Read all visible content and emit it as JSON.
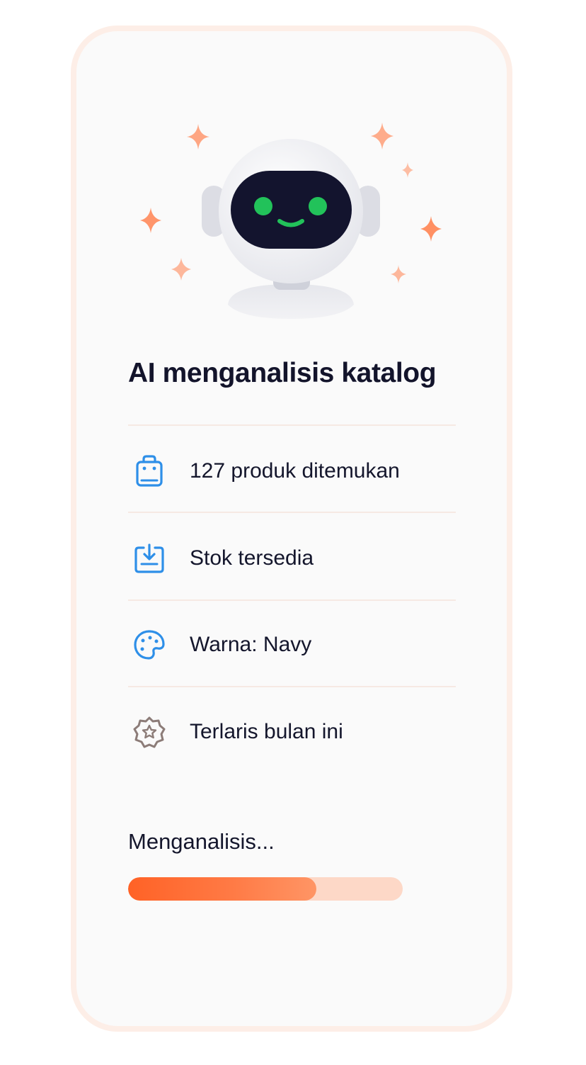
{
  "analysis": {
    "title": "AI menganalisis katalog",
    "items": [
      {
        "icon": "shopping-bag-icon",
        "label": "127 produk ditemukan"
      },
      {
        "icon": "box-download-icon",
        "label": "Stok tersedia"
      },
      {
        "icon": "color-palette-icon",
        "label": "Warna: Navy"
      },
      {
        "icon": "star-badge-icon",
        "label": "Terlaris bulan ini"
      }
    ],
    "status_text": "Menganalisis...",
    "progress_fraction": 0.685
  },
  "colors": {
    "accent": "#FF6A2B",
    "accent_light": "#FDD8C7",
    "icon_blue": "#2E8FE8",
    "icon_taupe": "#8C7C78",
    "robot_screen": "#13142E",
    "robot_eyes": "#22C25A",
    "sparkle": "#FF8A5B",
    "card_border": "#FDEEE7",
    "text": "#14162C"
  }
}
